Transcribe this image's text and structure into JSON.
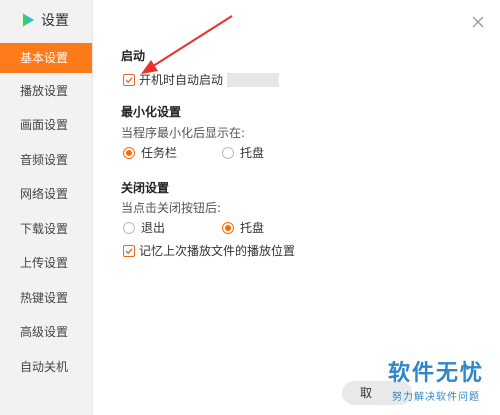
{
  "app": {
    "title": "设置"
  },
  "sidebar": {
    "items": [
      {
        "label": "基本设置",
        "active": true
      },
      {
        "label": "播放设置",
        "active": false
      },
      {
        "label": "画面设置",
        "active": false
      },
      {
        "label": "音频设置",
        "active": false
      },
      {
        "label": "网络设置",
        "active": false
      },
      {
        "label": "下载设置",
        "active": false
      },
      {
        "label": "上传设置",
        "active": false
      },
      {
        "label": "热键设置",
        "active": false
      },
      {
        "label": "高级设置",
        "active": false
      },
      {
        "label": "自动关机",
        "active": false
      }
    ]
  },
  "startup": {
    "title": "启动",
    "autostart_label": "开机时自动启动",
    "autostart_checked": true
  },
  "minimize": {
    "title": "最小化设置",
    "hint": "当程序最小化后显示在:",
    "options": [
      {
        "label": "任务栏",
        "selected": true
      },
      {
        "label": "托盘",
        "selected": false
      }
    ]
  },
  "close": {
    "title": "关闭设置",
    "hint": "当点击关闭按钮后:",
    "options": [
      {
        "label": "退出",
        "selected": false
      },
      {
        "label": "托盘",
        "selected": true
      }
    ],
    "remember_label": "记忆上次播放文件的播放位置",
    "remember_checked": true
  },
  "footer": {
    "partial_button_label": "取"
  },
  "watermark": {
    "title": "软件无忧",
    "subtitle": "努力解决软件问题"
  },
  "colors": {
    "accent": "#ff7a1a",
    "annotation_arrow": "#e8322d",
    "watermark": "#2f86c8"
  }
}
